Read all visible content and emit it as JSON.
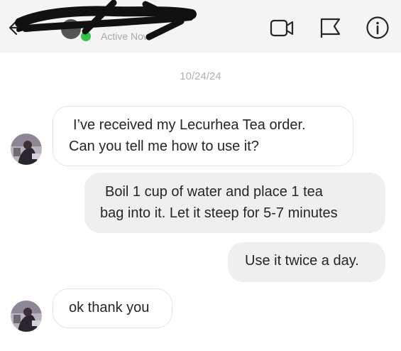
{
  "header": {
    "status_text": "Active Now",
    "icons": [
      "back-arrow-icon",
      "video-call-icon",
      "flag-icon",
      "info-icon"
    ],
    "online_color": "#31c24a"
  },
  "conversation": {
    "date": "10/24/24",
    "messages": [
      {
        "sender": "contact",
        "lines": [
          "I’ve received my Lecurhea Tea order.",
          "Can you tell me how to use it?"
        ]
      },
      {
        "sender": "self",
        "lines": [
          "Boil 1 cup of water and place 1 tea",
          "bag into it. Let it steep for 5-7 minutes"
        ]
      },
      {
        "sender": "self",
        "lines": [
          "Use it twice a day."
        ]
      },
      {
        "sender": "contact",
        "lines": [
          "ok thank you"
        ]
      }
    ]
  }
}
